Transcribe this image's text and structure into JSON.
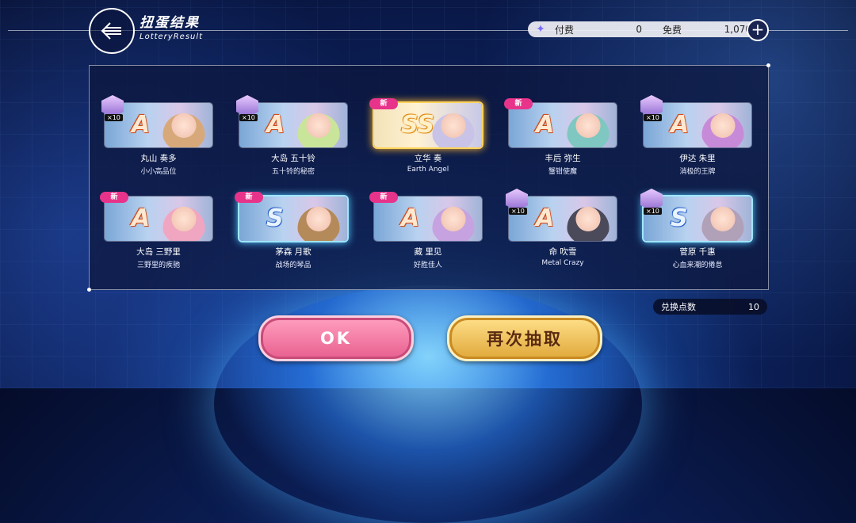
{
  "header": {
    "title_cn": "扭蛋结果",
    "title_en": "LotteryResult"
  },
  "currency": {
    "paid_label": "付费",
    "paid_value": "0",
    "free_label": "免费",
    "free_value": "1,070"
  },
  "cards": [
    {
      "rarity": "A",
      "name": "丸山 奏多",
      "sub": "小小高品位",
      "new": "",
      "dup": "×10",
      "hair": "#d7a97a"
    },
    {
      "rarity": "A",
      "name": "大岛 五十铃",
      "sub": "五十铃的秘密",
      "new": "",
      "dup": "×10",
      "hair": "#c9e59a"
    },
    {
      "rarity": "SS",
      "name": "立华 奏",
      "sub": "Earth Angel",
      "new": "新",
      "dup": "",
      "hair": "#c9c3e8"
    },
    {
      "rarity": "A",
      "name": "丰后 弥生",
      "sub": "蟹钳使魔",
      "new": "新",
      "dup": "",
      "hair": "#7fc7c1"
    },
    {
      "rarity": "A",
      "name": "伊达 朱里",
      "sub": "消极的王牌",
      "new": "",
      "dup": "×10",
      "hair": "#c78ad8"
    },
    {
      "rarity": "A",
      "name": "大岛 三野里",
      "sub": "三野里的疾驰",
      "new": "新",
      "dup": "",
      "hair": "#f0a6c0"
    },
    {
      "rarity": "S",
      "name": "茅森 月歌",
      "sub": "战场的琴品",
      "new": "新",
      "dup": "",
      "hair": "#b58a5a"
    },
    {
      "rarity": "A",
      "name": "藏 里见",
      "sub": "好胜佳人",
      "new": "新",
      "dup": "",
      "hair": "#c6a2e0"
    },
    {
      "rarity": "A",
      "name": "命 吹雪",
      "sub": "Metal Crazy",
      "new": "",
      "dup": "×10",
      "hair": "#4a4a5a"
    },
    {
      "rarity": "S",
      "name": "菅原 千惠",
      "sub": "心血来潮的倦怠",
      "new": "",
      "dup": "×10",
      "hair": "#b0a0b8"
    }
  ],
  "exchange": {
    "label": "兑换点数",
    "value": "10"
  },
  "buttons": {
    "ok": "OK",
    "again": "再次抽取"
  },
  "colors": {
    "ok_button": "#e85f8f",
    "again_button": "#e0a83a",
    "new_badge": "#e8338a"
  }
}
